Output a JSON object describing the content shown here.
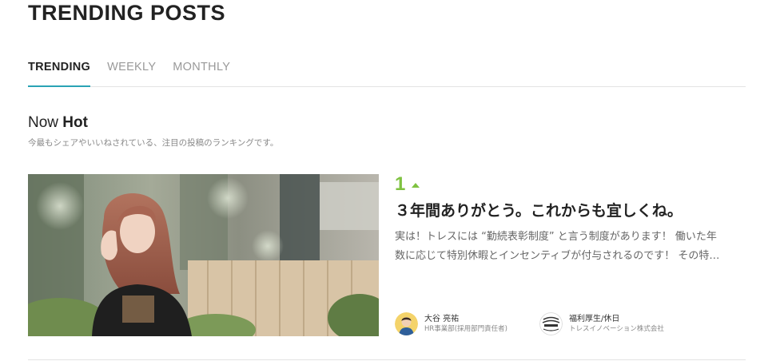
{
  "header": {
    "title": "TRENDING POSTS"
  },
  "tabs": [
    {
      "label": "TRENDING",
      "active": true
    },
    {
      "label": "WEEKLY",
      "active": false
    },
    {
      "label": "MONTHLY",
      "active": false
    }
  ],
  "section": {
    "heading_light": "Now ",
    "heading_bold": "Hot",
    "subtitle": "今最もシェアやいいねされている、注目の投稿のランキングです。"
  },
  "post": {
    "rank": "1",
    "rank_trend_icon": "triangle-up-icon",
    "title": "３年間ありがとう。これからも宜しくね。",
    "excerpt_line1": "実は！トレスには “勤続表彰制度” と言う制度があります！ 働いた年",
    "excerpt_line2": "数に応じて特別休暇とインセンティブが付与されるのです！ その特…",
    "author": {
      "name": "大谷 亮祐",
      "role": "HR事業部(採用部門責任者)"
    },
    "category": {
      "name": "福利厚生/休日",
      "org": "トレスイノベーション株式会社"
    }
  },
  "colors": {
    "accent_tab": "#2aa3b5",
    "rank_green": "#7fc241"
  }
}
